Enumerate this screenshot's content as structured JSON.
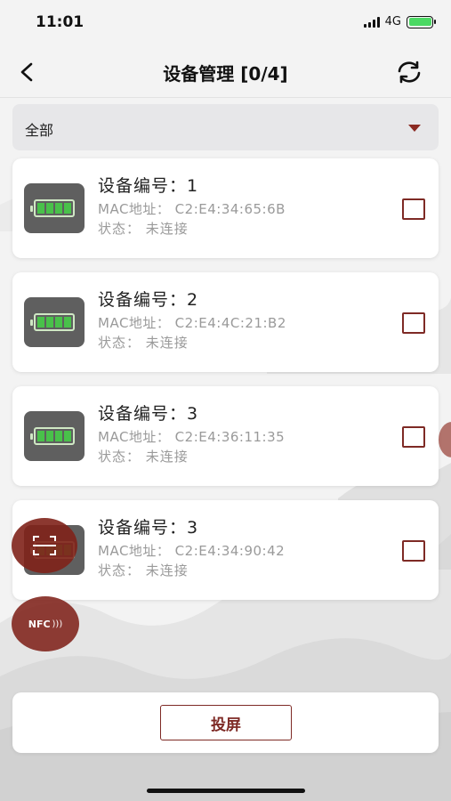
{
  "status_bar": {
    "time": "11:01",
    "network": "4G"
  },
  "nav": {
    "title": "设备管理 [0/4]",
    "back_icon": "chevron-left-icon",
    "refresh_icon": "refresh-icon"
  },
  "filter": {
    "selected": "全部",
    "arrow_color": "#8b2a22"
  },
  "devices": [
    {
      "name": "设备编号：1",
      "mac": "MAC地址：  C2:E4:34:65:6B",
      "state": "状态：  未连接",
      "checked": false
    },
    {
      "name": "设备编号：2",
      "mac": "MAC地址：  C2:E4:4C:21:B2",
      "state": "状态：  未连接",
      "checked": false
    },
    {
      "name": "设备编号：3",
      "mac": "MAC地址：  C2:E4:36:11:35",
      "state": "状态：  未连接",
      "checked": false
    },
    {
      "name": "设备编号：3",
      "mac": "MAC地址：  C2:E4:34:90:42",
      "state": "状态：  未连接",
      "checked": false
    }
  ],
  "fabs": {
    "scan_icon": "scan-icon",
    "nfc_label": "NFC"
  },
  "bottom": {
    "cast_label": "投屏"
  },
  "colors": {
    "accent": "#7e2a25",
    "battery_green": "#49c14a",
    "card_bg": "#ffffff"
  }
}
